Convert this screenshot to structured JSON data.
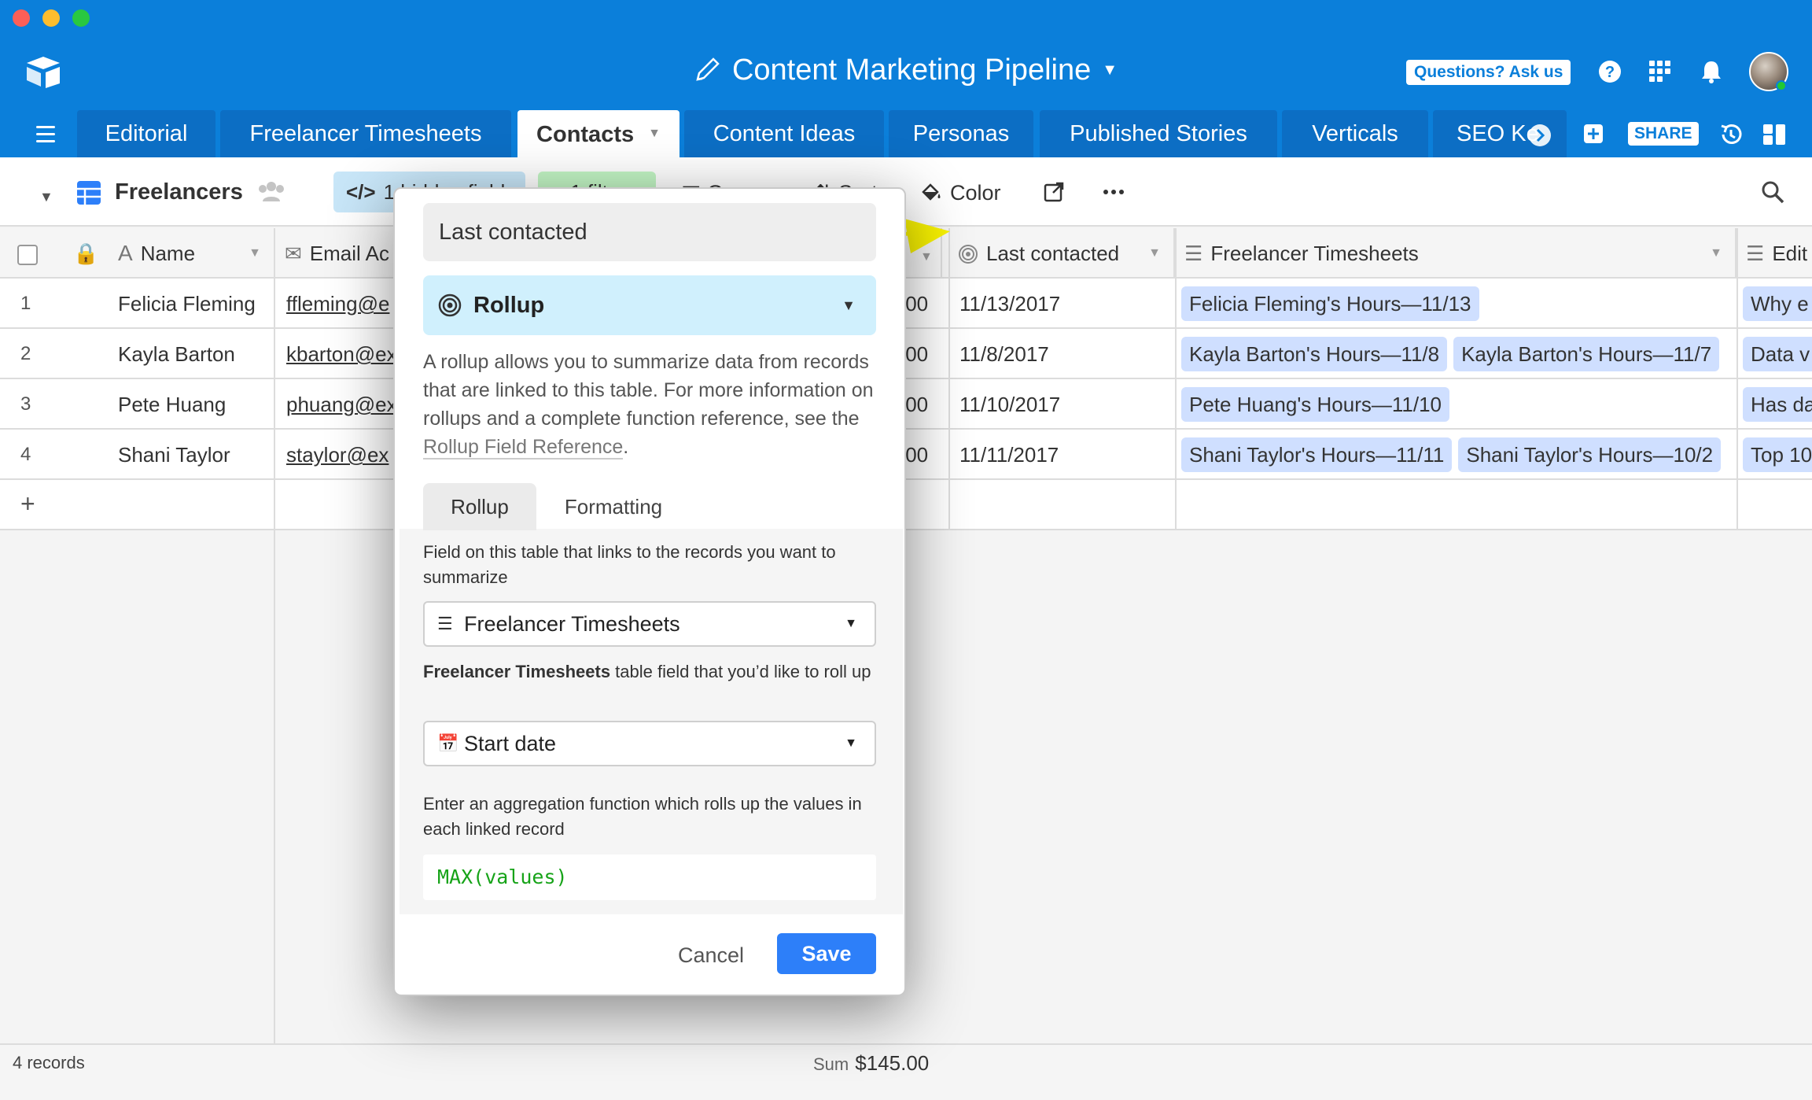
{
  "app": {
    "base_title": "Content Marketing Pipeline",
    "ask_label": "Questions? Ask us",
    "share_label": "SHARE"
  },
  "tabs": [
    {
      "label": "Editorial"
    },
    {
      "label": "Freelancer Timesheets"
    },
    {
      "label": "Contacts",
      "active": true
    },
    {
      "label": "Content Ideas"
    },
    {
      "label": "Personas"
    },
    {
      "label": "Published Stories"
    },
    {
      "label": "Verticals"
    },
    {
      "label": "SEO Ke"
    }
  ],
  "view": {
    "name": "Freelancers",
    "hidden_fields": "1 hidden field",
    "filter": "1 filter",
    "group": "Group",
    "sort": "Sort",
    "color": "Color"
  },
  "columns": {
    "name": "Name",
    "email": "Email Ac",
    "last_contacted": "Last contacted",
    "timesheets": "Freelancer Timesheets",
    "editorial": "Edit"
  },
  "rows": [
    {
      "num": "1",
      "name": "Felicia Fleming",
      "email": "ffleming@e",
      "rate": ".00",
      "last": "11/13/2017",
      "sheets": [
        "Felicia Fleming's Hours—11/13"
      ],
      "edit": "Why e"
    },
    {
      "num": "2",
      "name": "Kayla Barton",
      "email": "kbarton@ex",
      "rate": ".00",
      "last": "11/8/2017",
      "sheets": [
        "Kayla Barton's Hours—11/8",
        "Kayla Barton's Hours—11/7"
      ],
      "edit": "Data v"
    },
    {
      "num": "3",
      "name": "Pete Huang",
      "email": "phuang@ex",
      "rate": ".00",
      "last": "11/10/2017",
      "sheets": [
        "Pete Huang's Hours—11/10"
      ],
      "edit": "Has da"
    },
    {
      "num": "4",
      "name": "Shani Taylor",
      "email": "staylor@ex",
      "rate": ".00",
      "last": "11/11/2017",
      "sheets": [
        "Shani Taylor's Hours—11/11",
        "Shani Taylor's Hours—10/2"
      ],
      "edit": "Top 10"
    }
  ],
  "footer": {
    "records": "4 records",
    "sum_label": "Sum",
    "sum_value": "$145.00"
  },
  "dialog": {
    "field_name": "Last contacted",
    "type": "Rollup",
    "description_1": "A rollup allows you to summarize data from records that are linked to this table. For more information on rollups and a complete function reference, see the ",
    "description_link": "Rollup Field Reference",
    "description_2": ".",
    "tab_rollup": "Rollup",
    "tab_formatting": "Formatting",
    "link_label": "Field on this table that links to the records you want to summarize",
    "link_value": "Freelancer Timesheets",
    "rollup_field_bold": "Freelancer Timesheets",
    "rollup_field_rest": " table field that you’d like to roll up",
    "rollup_field_value": "Start date",
    "aggregation_label": "Enter an aggregation function which rolls up the values in each linked record",
    "formula": "MAX(values)",
    "cancel": "Cancel",
    "save": "Save"
  },
  "colors": {
    "brand_blue": "#0b7fda",
    "rollup_bg": "#d0f0fd",
    "chip_bg": "#cfdfff",
    "save_blue": "#2d7ff9",
    "formula_green": "#16a318",
    "arrow_yellow": "#f8f200"
  }
}
